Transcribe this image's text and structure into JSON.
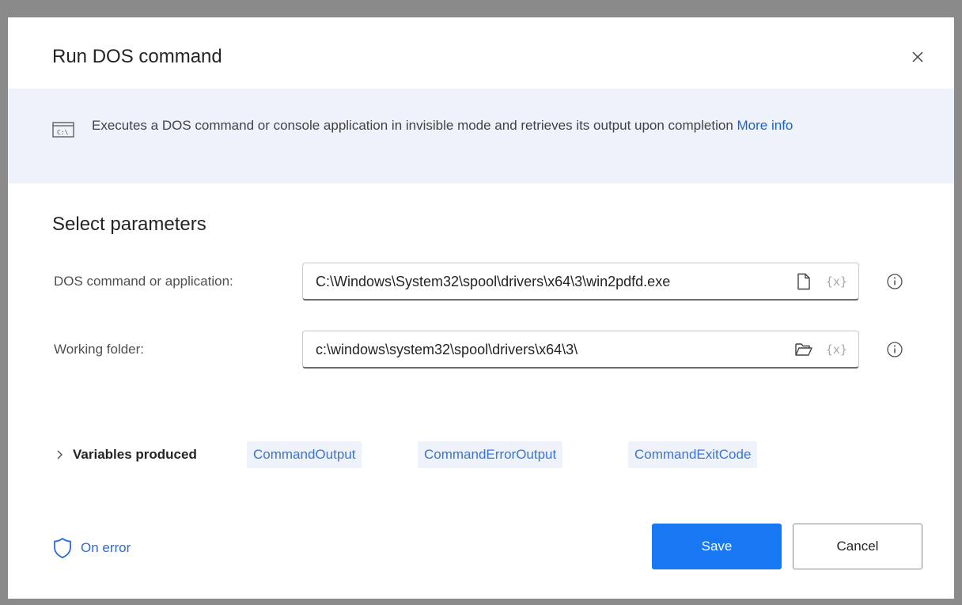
{
  "dialog": {
    "title": "Run DOS command",
    "close_icon": "close-icon"
  },
  "banner": {
    "icon": "console-icon",
    "description": "Executes a DOS command or console application in invisible mode and retrieves its output upon completion",
    "link_text": "More info"
  },
  "parameters": {
    "section_title": "Select parameters",
    "command": {
      "label": "DOS command or application:",
      "value": "C:\\Windows\\System32\\spool\\drivers\\x64\\3\\win2pdfd.exe",
      "icon": "file-icon",
      "variable_button": "{x}"
    },
    "working_folder": {
      "label": "Working folder:",
      "value": "c:\\windows\\system32\\spool\\drivers\\x64\\3\\",
      "icon": "folder-icon",
      "variable_button": "{x}"
    }
  },
  "variables": {
    "label": "Variables produced",
    "items": [
      "CommandOutput",
      "CommandErrorOutput",
      "CommandExitCode"
    ]
  },
  "footer": {
    "on_error_label": "On error",
    "save_label": "Save",
    "cancel_label": "Cancel"
  },
  "colors": {
    "accent": "#1877f2",
    "banner_bg": "#eef3fb",
    "link": "#2d6ad6"
  }
}
